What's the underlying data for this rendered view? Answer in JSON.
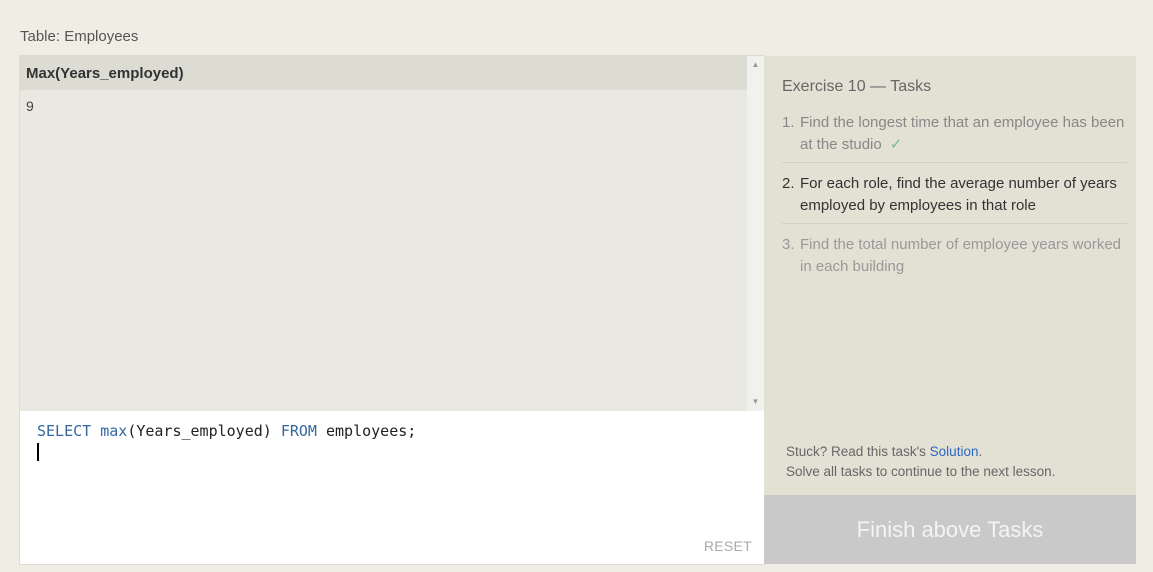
{
  "table_caption": "Table: Employees",
  "results": {
    "column_header": "Max(Years_employed)",
    "rows": [
      "9"
    ]
  },
  "editor": {
    "keyword_select": "SELECT",
    "func": "max",
    "args": "(Years_employed)",
    "keyword_from": "FROM",
    "table": "employees;",
    "reset_label": "RESET"
  },
  "exercise": {
    "title": "Exercise 10 — Tasks",
    "tasks": [
      {
        "num": "1.",
        "text": "Find the longest time that an employee has been at the studio",
        "check": "✓"
      },
      {
        "num": "2.",
        "text": "For each role, find the average number of years employed by employees in that role"
      },
      {
        "num": "3.",
        "text": "Find the total number of employee years worked in each building"
      }
    ],
    "stuck_prefix": "Stuck? Read this task's",
    "solution_label": "Solution",
    "stuck_suffix": ".",
    "continue_text": "Solve all tasks to continue to the next lesson.",
    "finish_button": "Finish above Tasks"
  }
}
